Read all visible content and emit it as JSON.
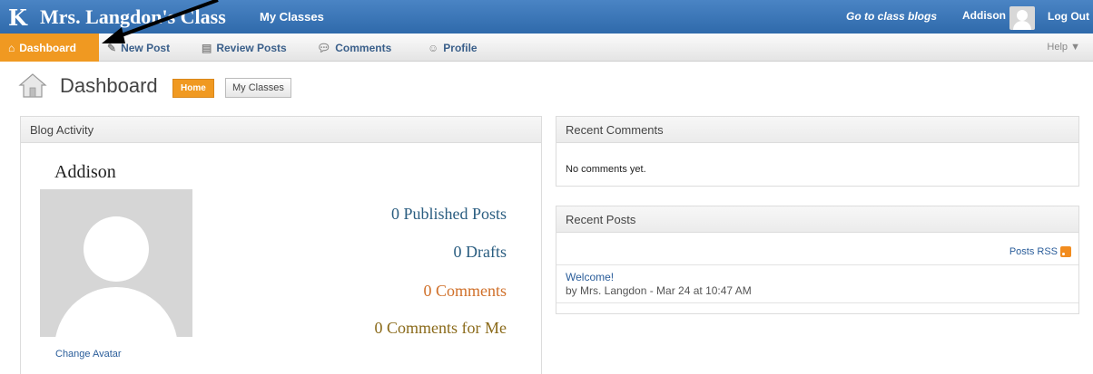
{
  "topbar": {
    "logo": "K",
    "site_title": "Mrs. Langdon's Class",
    "my_classes": "My Classes",
    "go_to_class_blogs": "Go to class blogs",
    "user_name": "Addison",
    "logout": "Log Out"
  },
  "nav": {
    "dashboard": "Dashboard",
    "new_post": "New Post",
    "review_posts": "Review Posts",
    "comments": "Comments",
    "profile": "Profile",
    "help": "Help ▼"
  },
  "page": {
    "title": "Dashboard",
    "home_button": "Home",
    "my_classes_button": "My Classes"
  },
  "blog_activity": {
    "header": "Blog Activity",
    "student_name": "Addison",
    "change_avatar": "Change Avatar",
    "published_posts": "0 Published Posts",
    "drafts": "0 Drafts",
    "comments": "0 Comments",
    "comments_for_me": "0 Comments for Me"
  },
  "recent_comments": {
    "header": "Recent Comments",
    "empty_text": "No comments yet."
  },
  "recent_posts": {
    "header": "Recent Posts",
    "rss_label": "Posts RSS",
    "posts": [
      {
        "title": "Welcome!",
        "meta": "by Mrs. Langdon - Mar 24 at 10:47 AM"
      }
    ]
  },
  "colors": {
    "topbar": "#3a75b8",
    "accent_orange": "#f09921",
    "link_blue": "#2a5d9a"
  }
}
